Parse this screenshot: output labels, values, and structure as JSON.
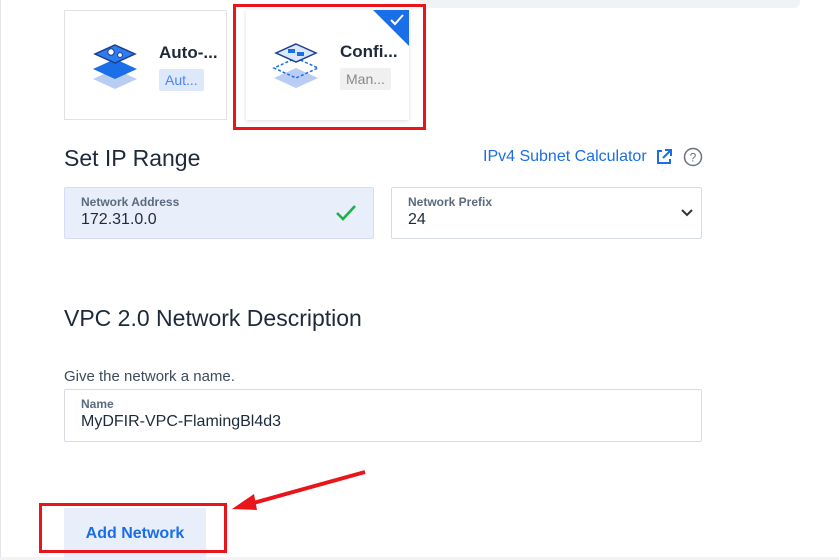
{
  "options": {
    "auto": {
      "title": "Auto-...",
      "tag": "Aut..."
    },
    "manual": {
      "title": "Confi...",
      "tag": "Man...",
      "selected": true
    }
  },
  "ip_range": {
    "heading": "Set IP Range",
    "calculator_link": "IPv4 Subnet Calculator",
    "network_address": {
      "label": "Network Address",
      "value": "172.31.0.0"
    },
    "network_prefix": {
      "label": "Network Prefix",
      "value": "24"
    }
  },
  "description": {
    "heading": "VPC 2.0 Network Description",
    "hint": "Give the network a name.",
    "name_label": "Name",
    "name_value": "MyDFIR-VPC-FlamingBl4d3"
  },
  "actions": {
    "add_network": "Add Network"
  },
  "colors": {
    "accent": "#1a6ee8",
    "annotation_red": "#e8161b",
    "valid_green": "#19b24b"
  },
  "icons": [
    "auto-network-icon",
    "manual-network-icon",
    "check-icon",
    "external-link-icon",
    "help-icon",
    "chevron-down-icon",
    "valid-check-icon"
  ]
}
